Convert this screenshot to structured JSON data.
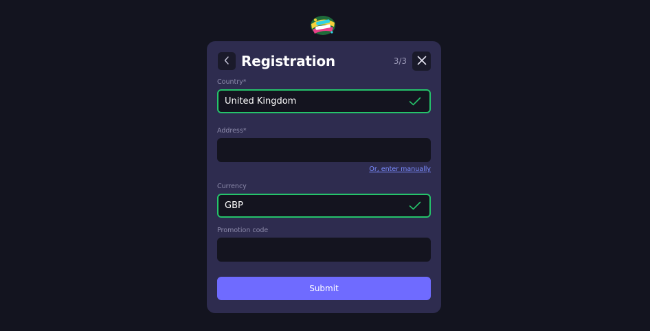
{
  "header": {
    "title": "Registration",
    "step": "3/3"
  },
  "form": {
    "country": {
      "label": "Country*",
      "value": "United Kingdom",
      "valid": true
    },
    "address": {
      "label": "Address*",
      "value": "",
      "placeholder": ""
    },
    "manual_link": "Or, enter manually",
    "currency": {
      "label": "Currency",
      "value": "GBP",
      "valid": true
    },
    "promo": {
      "label": "Promotion code",
      "value": "",
      "placeholder": ""
    },
    "submit_label": "Submit"
  },
  "icons": {
    "logo": "funky-jackpot-logo-icon",
    "back": "chevron-left-icon",
    "close": "close-icon",
    "valid": "checkmark-icon"
  },
  "colors": {
    "page_bg": "#13141f",
    "modal_bg": "#2e2c4f",
    "field_bg": "#14141f",
    "valid_border": "#25c46b",
    "accent": "#6f6bff",
    "link": "#7b8cff"
  }
}
